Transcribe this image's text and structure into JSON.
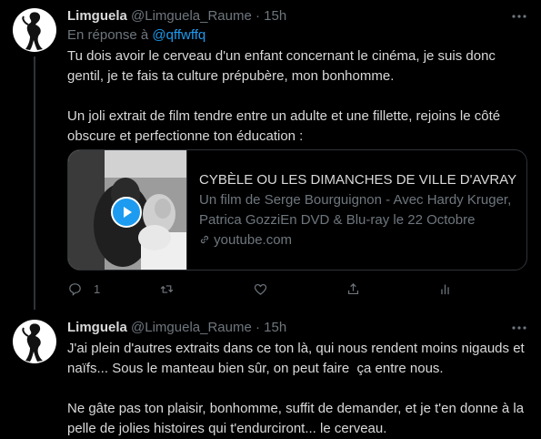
{
  "tweets": [
    {
      "name": "Limguela",
      "handle": "@Limguela_Raume",
      "separator": "·",
      "time": "15h",
      "reply_prefix": "En réponse à",
      "reply_handle": "@qffwffq",
      "text": "Tu dois avoir le cerveau d'un enfant concernant le cinéma, je suis donc gentil, je te fais ta culture prépubère, mon bonhomme.\n\nUn joli extrait de film tendre entre un adulte et une fillette, rejoins le côté obscure et perfectionne ton éducation :",
      "card": {
        "title": "CYBÈLE OU LES DIMANCHES DE VILLE D'AVRAY - E...",
        "description": "Un film de Serge Bourguignon - Avec Hardy Kruger, Patrica GozziEn DVD & Blu-ray le 22 Octobre",
        "domain": "youtube.com"
      },
      "reply_count": "1"
    },
    {
      "name": "Limguela",
      "handle": "@Limguela_Raume",
      "separator": "·",
      "time": "15h",
      "text": "J'ai plein d'autres extraits dans ce ton là, qui nous rendent moins nigauds et naïfs... Sous le manteau bien sûr, on peut faire  ça entre nous.\n\nNe gâte pas ton plaisir, bonhomme, suffit de demander, et je t'en donne à la pelle de jolies histoires qui t'endurciront... le cerveau."
    }
  ],
  "colors": {
    "background": "#000000",
    "text": "#d9d9d9",
    "muted": "#6e767d",
    "accent": "#1d9bf0",
    "border": "#2f3336"
  },
  "icons": [
    "more-icon",
    "reply-icon",
    "retweet-icon",
    "like-icon",
    "share-icon",
    "analytics-icon",
    "play-icon",
    "link-icon"
  ]
}
